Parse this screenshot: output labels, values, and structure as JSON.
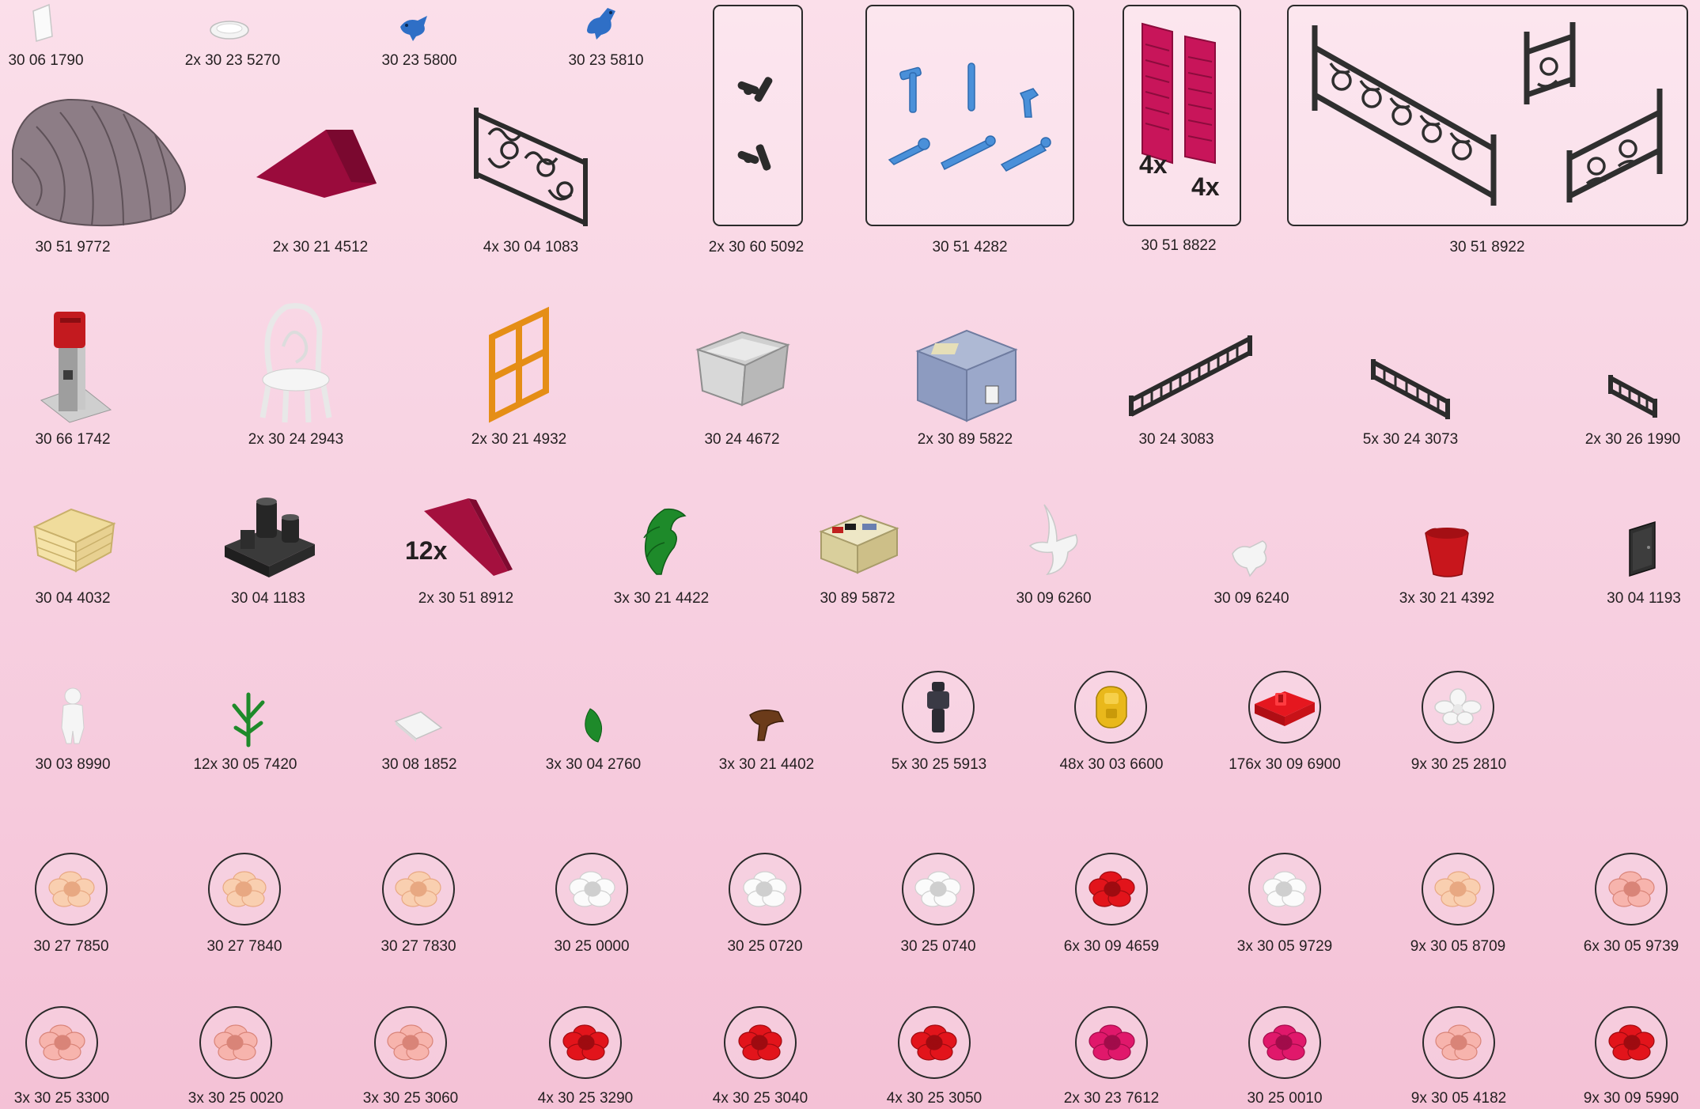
{
  "colors": {
    "background_top": "#fbdfea",
    "background_bottom": "#f4c1d6",
    "outline": "#2a2a2a",
    "text": "#231f20"
  },
  "parts": [
    {
      "id": "p01",
      "label": "30 06 1790",
      "icon": "white-card-icon"
    },
    {
      "id": "p02",
      "label": "2x 30 23 5270",
      "icon": "white-dish-icon"
    },
    {
      "id": "p03",
      "label": "30 23 5800",
      "icon": "blue-bird-icon"
    },
    {
      "id": "p04",
      "label": "30 23 5810",
      "icon": "blue-bird-icon"
    },
    {
      "id": "p05",
      "label": "30 51 9772",
      "icon": "transparent-canopy-icon"
    },
    {
      "id": "p06",
      "label": "2x 30 21 4512",
      "icon": "magenta-roof-slope-icon"
    },
    {
      "id": "p07",
      "label": "4x 30 04 1083",
      "icon": "black-railing-icon"
    },
    {
      "id": "p08",
      "label": "2x 30 60 5092",
      "icon": "black-hinge-icon"
    },
    {
      "id": "p09",
      "label": "30 51 4282",
      "icon": "blue-tools-icon"
    },
    {
      "id": "p10",
      "label": "30 51 8822",
      "icon": "magenta-shutter-icon",
      "qty_left": "4x",
      "qty_right": "4x"
    },
    {
      "id": "p11",
      "label": "30 51 8922",
      "icon": "black-fence-icon"
    },
    {
      "id": "p12",
      "label": "30 66 1742",
      "icon": "red-mailbox-icon"
    },
    {
      "id": "p13",
      "label": "2x 30 24 2943",
      "icon": "white-chair-icon"
    },
    {
      "id": "p14",
      "label": "2x 30 21 4932",
      "icon": "orange-window-icon"
    },
    {
      "id": "p15",
      "label": "30 24 4672",
      "icon": "grey-crate-icon"
    },
    {
      "id": "p16",
      "label": "2x 30 89 5822",
      "icon": "blue-box-icon"
    },
    {
      "id": "p17",
      "label": "30 24 3083",
      "icon": "black-fence-long-icon"
    },
    {
      "id": "p18",
      "label": "5x 30 24 3073",
      "icon": "black-fence-medium-icon"
    },
    {
      "id": "p19",
      "label": "2x 30 26 1990",
      "icon": "black-fence-short-icon"
    },
    {
      "id": "p20",
      "label": "30 04 4032",
      "icon": "tan-basket-icon"
    },
    {
      "id": "p21",
      "label": "30 04 1183",
      "icon": "black-stove-icon"
    },
    {
      "id": "p22",
      "label": "2x 30 51 8912",
      "icon": "magenta-wedge-icon",
      "qty_left": "12x"
    },
    {
      "id": "p23",
      "label": "3x 30 21 4422",
      "icon": "green-leaves-icon"
    },
    {
      "id": "p24",
      "label": "30 89 5872",
      "icon": "tan-package-icon"
    },
    {
      "id": "p25",
      "label": "30 09 6260",
      "icon": "white-dove-flying-icon"
    },
    {
      "id": "p26",
      "label": "30 09 6240",
      "icon": "white-dove-icon"
    },
    {
      "id": "p27",
      "label": "3x 30 21 4392",
      "icon": "red-flowerpot-icon"
    },
    {
      "id": "p28",
      "label": "30 04 1193",
      "icon": "black-door-icon"
    },
    {
      "id": "p29",
      "label": "30 03 8990",
      "icon": "white-figure-icon"
    },
    {
      "id": "p30",
      "label": "12x 30 05 7420",
      "icon": "green-stem-icon"
    },
    {
      "id": "p31",
      "label": "30 08 1852",
      "icon": "white-paper-icon"
    },
    {
      "id": "p32",
      "label": "3x 30 04 2760",
      "icon": "green-leaf-small-icon"
    },
    {
      "id": "p33",
      "label": "3x 30 21 4402",
      "icon": "brown-bracket-icon"
    },
    {
      "id": "p34",
      "label": "5x 30 25 5913",
      "icon": "black-stud-icon"
    },
    {
      "id": "p35",
      "label": "48x 30 03 6600",
      "icon": "yellow-stud-icon"
    },
    {
      "id": "p36",
      "label": "176x 30 09 6900",
      "icon": "red-tile-icon"
    },
    {
      "id": "p37",
      "label": "9x 30 25 2810",
      "icon": "white-flower-icon"
    },
    {
      "id": "p38",
      "label": "30 27 7850",
      "icon": "peach-rose-icon"
    },
    {
      "id": "p39",
      "label": "30 27 7840",
      "icon": "peach-rose-icon"
    },
    {
      "id": "p40",
      "label": "30 27 7830",
      "icon": "peach-rose-icon"
    },
    {
      "id": "p41",
      "label": "30 25 0000",
      "icon": "white-rose-icon"
    },
    {
      "id": "p42",
      "label": "30 25 0720",
      "icon": "white-rose-icon"
    },
    {
      "id": "p43",
      "label": "30 25 0740",
      "icon": "white-rose-icon"
    },
    {
      "id": "p44",
      "label": "6x 30 09 4659",
      "icon": "red-rose-icon"
    },
    {
      "id": "p45",
      "label": "3x 30 05 9729",
      "icon": "white-rose-icon"
    },
    {
      "id": "p46",
      "label": "9x 30 05 8709",
      "icon": "peach-rose-icon"
    },
    {
      "id": "p47",
      "label": "6x 30 05 9739",
      "icon": "pink-rose-icon"
    },
    {
      "id": "p48",
      "label": "3x 30 25 3300",
      "icon": "pink-rose-icon"
    },
    {
      "id": "p49",
      "label": "3x 30 25 0020",
      "icon": "pink-rose-icon"
    },
    {
      "id": "p50",
      "label": "3x 30 25 3060",
      "icon": "pink-rose-icon"
    },
    {
      "id": "p51",
      "label": "4x 30 25 3290",
      "icon": "red-rose-icon"
    },
    {
      "id": "p52",
      "label": "4x 30 25 3040",
      "icon": "red-rose-icon"
    },
    {
      "id": "p53",
      "label": "4x 30 25 3050",
      "icon": "red-rose-icon"
    },
    {
      "id": "p54",
      "label": "2x 30 23 7612",
      "icon": "magenta-rose-icon"
    },
    {
      "id": "p55",
      "label": "30 25 0010",
      "icon": "magenta-rose-icon"
    },
    {
      "id": "p56",
      "label": "9x 30 05 4182",
      "icon": "pink-rose-icon"
    },
    {
      "id": "p57",
      "label": "9x 30 09 5990",
      "icon": "red-rose-icon"
    }
  ]
}
